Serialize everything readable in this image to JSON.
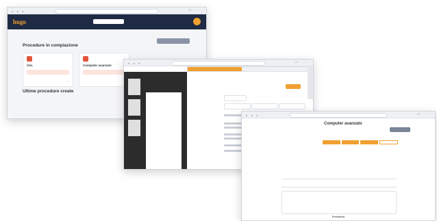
{
  "window1": {
    "logo": "hugo",
    "search_placeholder": "",
    "page_title": "Procedure in compiazione",
    "new_button_label": "",
    "cards": [
      {
        "badge": "",
        "title": "SAL",
        "alert": "",
        "footer": "",
        "arrow": "›"
      },
      {
        "badge": "",
        "title": "Computer avanzato",
        "alert": "",
        "footer": "",
        "arrow": "›"
      }
    ],
    "section2_title": "Ultime procedure create",
    "empty_text": ""
  },
  "window2": {
    "progress_percent": 45,
    "form_title": "",
    "form_sub": "",
    "chip_label": "",
    "inputs": [
      "",
      "",
      "",
      ""
    ],
    "button_label": ""
  },
  "window3": {
    "title": "Computer avanzato",
    "subtitle": "",
    "dark_button_label": "",
    "steps": [
      "",
      "",
      "",
      ""
    ],
    "question": "",
    "fields": [
      "",
      ""
    ],
    "textarea": "",
    "footer": "Prossimo"
  },
  "colors": {
    "accent": "#f0a030",
    "appbar": "#1f2a44",
    "card_icon": "#e2553d"
  }
}
